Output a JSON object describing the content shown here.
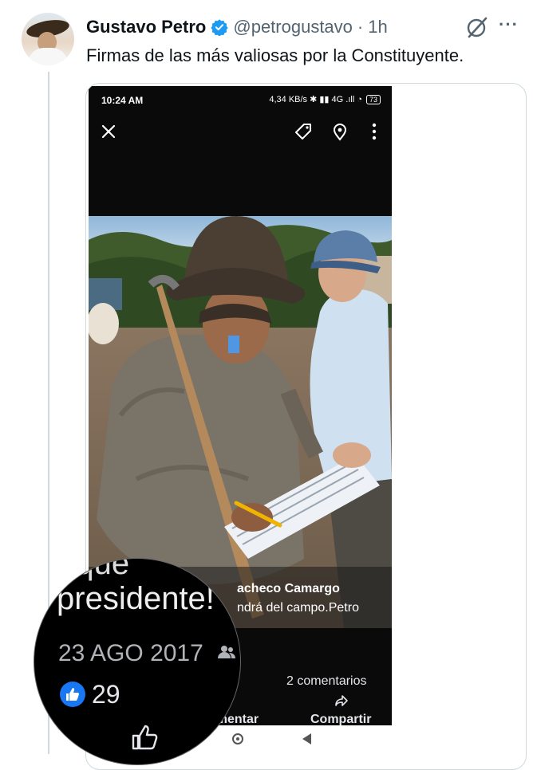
{
  "tweet": {
    "author_name": "Gustavo Petro",
    "handle": "@petrogustavo",
    "separator": "·",
    "time": "1h",
    "more": "···",
    "text": "Firmas de las más valiosas por la Constituyente."
  },
  "screenshot": {
    "status_time": "10:24 AM",
    "status_right": "4,34 KB/s ✱ ▮▮ 4G .ıll ◔",
    "battery": "73",
    "photo_caption_name": "acheco Camargo",
    "photo_caption_text": "ndrá del campo.Petro",
    "comments": "2 comentarios",
    "comment_action": "omentar",
    "share_action": "Compartir",
    "magnified": {
      "line_top": "r que",
      "line_main": "presidente!",
      "date": "23 AGO 2017",
      "likes": "29"
    }
  },
  "colors": {
    "verified_blue": "#1d9bf0",
    "facebook_blue": "#1877f2",
    "muted": "#536471"
  }
}
